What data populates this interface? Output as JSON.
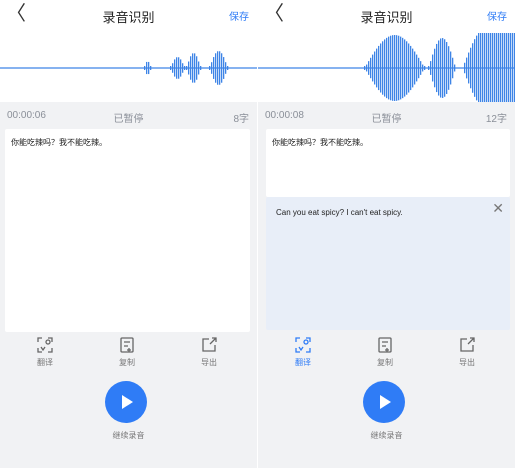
{
  "colors": {
    "accent": "#2f7cf6",
    "wave": "#3e84e6",
    "translation_bg": "#e8eef8"
  },
  "screens": [
    {
      "header": {
        "back_icon": "chevron-left-icon",
        "back_glyph": "〈",
        "title": "录音识别",
        "save_label": "保存"
      },
      "info": {
        "time": "00:00:06",
        "status": "已暂停",
        "count": "8字"
      },
      "transcript": "你能吃辣吗？我不能吃辣。",
      "actions": [
        {
          "label": "翻译",
          "icon": "translate-icon"
        },
        {
          "label": "复制",
          "icon": "copy-icon"
        },
        {
          "label": "导出",
          "icon": "export-icon"
        }
      ],
      "play_label": "继续录音"
    },
    {
      "header": {
        "back_icon": "chevron-left-icon",
        "back_glyph": "〈",
        "title": "录音识别",
        "save_label": "保存"
      },
      "info": {
        "time": "00:00:08",
        "status": "已暂停",
        "count": "12字"
      },
      "transcript": "你能吃辣吗？我不能吃辣。",
      "translation": "Can you eat spicy? I can't eat spicy.",
      "close_glyph": "✕",
      "actions": [
        {
          "label": "翻译",
          "icon": "translate-icon",
          "active": true
        },
        {
          "label": "复制",
          "icon": "copy-icon"
        },
        {
          "label": "导出",
          "icon": "export-icon"
        }
      ],
      "play_label": "继续录音"
    }
  ]
}
